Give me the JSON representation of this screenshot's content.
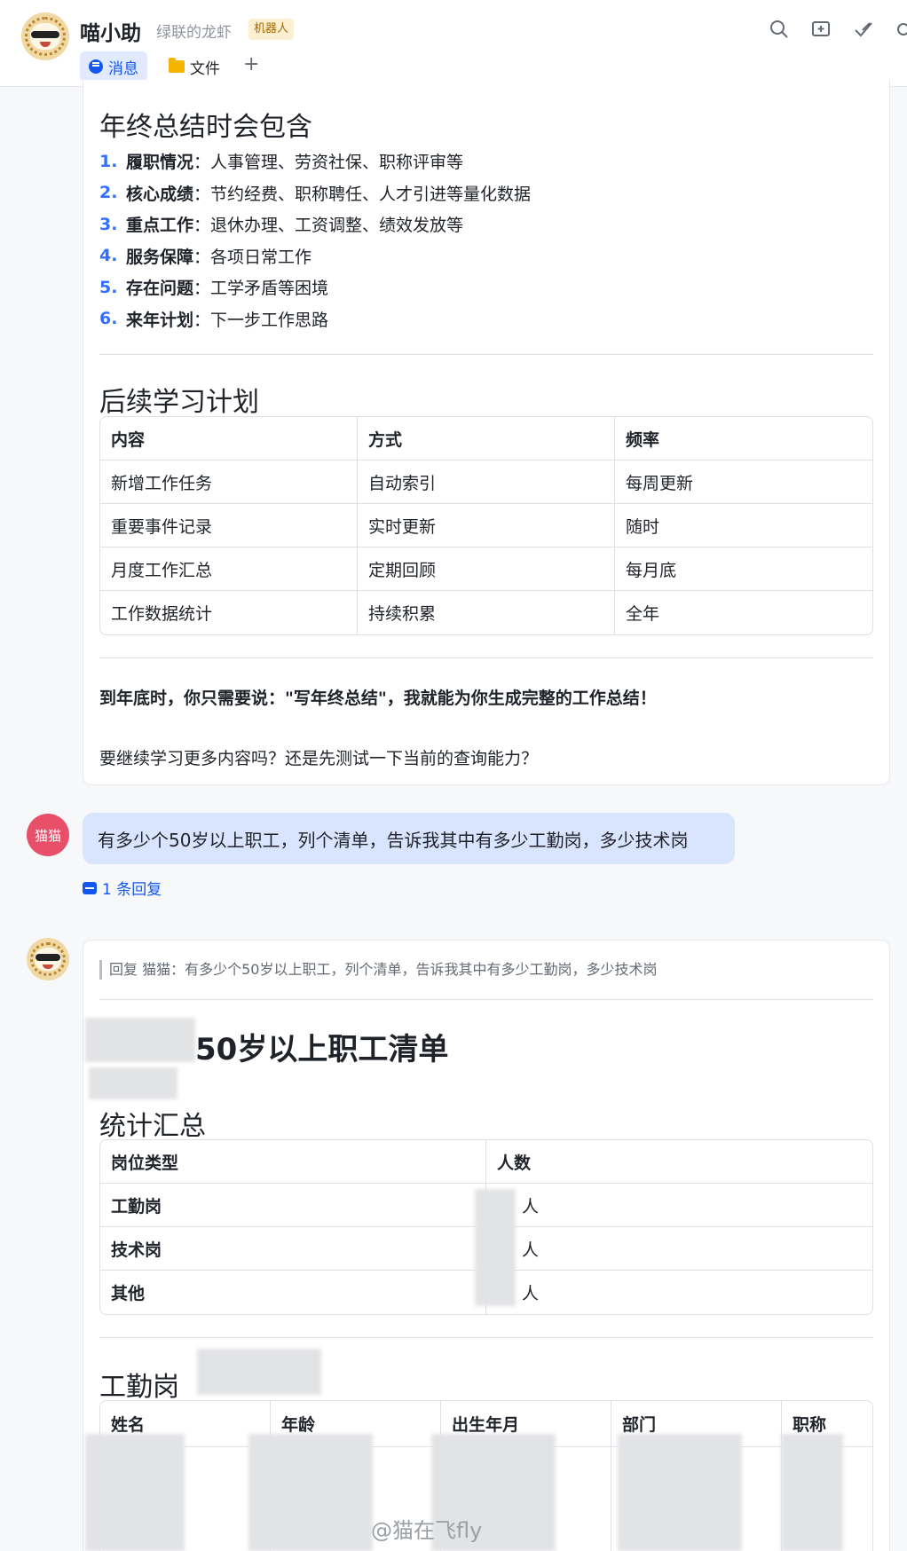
{
  "header": {
    "title": "喵小助",
    "subtitle": "绿联的龙虾",
    "badge": "机器人",
    "tabs": [
      {
        "label": "消息",
        "icon": "message-icon",
        "active": true
      },
      {
        "label": "文件",
        "icon": "folder-icon",
        "active": false
      }
    ],
    "add_tab": "+"
  },
  "card1": {
    "heading": "年终总结时会包含",
    "list": [
      {
        "num": "1.",
        "term": "履职情况",
        "desc": "：人事管理、劳资社保、职称评审等"
      },
      {
        "num": "2.",
        "term": "核心成绩",
        "desc": "：节约经费、职称聘任、人才引进等量化数据"
      },
      {
        "num": "3.",
        "term": "重点工作",
        "desc": "：退休办理、工资调整、绩效发放等"
      },
      {
        "num": "4.",
        "term": "服务保障",
        "desc": "：各项日常工作"
      },
      {
        "num": "5.",
        "term": "存在问题",
        "desc": "：工学矛盾等困境"
      },
      {
        "num": "6.",
        "term": "来年计划",
        "desc": "：下一步工作思路"
      }
    ],
    "plan_heading": "后续学习计划",
    "plan_table": {
      "headers": [
        "内容",
        "方式",
        "频率"
      ],
      "rows": [
        [
          "新增工作任务",
          "自动索引",
          "每周更新"
        ],
        [
          "重要事件记录",
          "实时更新",
          "随时"
        ],
        [
          "月度工作汇总",
          "定期回顾",
          "每月底"
        ],
        [
          "工作数据统计",
          "持续积累",
          "全年"
        ]
      ]
    },
    "closing_bold": "到年底时，你只需要说：\"写年终总结\"，我就能为你生成完整的工作总结！",
    "closing_question": "要继续学习更多内容吗？还是先测试一下当前的查询能力？"
  },
  "user_message": {
    "avatar_text": "猫猫",
    "text": "有多少个50岁以上职工，列个清单，告诉我其中有多少工勤岗，多少技术岗",
    "reply_count": "1 条回复"
  },
  "card2": {
    "quote": "回复 猫猫：有多少个50岁以上职工，列个清单，告诉我其中有多少工勤岗，多少技术岗",
    "title": "50岁以上职工清单",
    "summary_heading": "统计汇总",
    "summary_table": {
      "headers": [
        "岗位类型",
        "人数"
      ],
      "rows": [
        [
          "工勤岗",
          "人"
        ],
        [
          "技术岗",
          "人"
        ],
        [
          "其他",
          "人"
        ]
      ]
    },
    "section_heading": "工勤岗",
    "detail_headers": [
      "姓名",
      "年龄",
      "出生年月",
      "部门",
      "职称"
    ]
  },
  "watermark": "@猫在飞fly"
}
